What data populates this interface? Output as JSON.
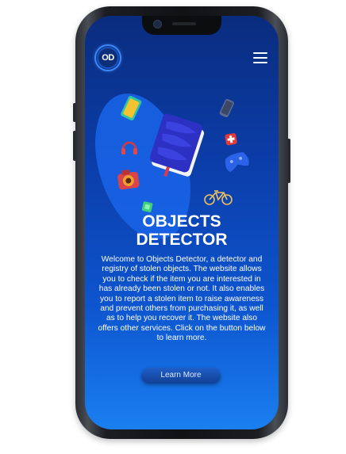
{
  "header": {
    "logo_text": "OD",
    "menu_icon": "hamburger-menu-icon"
  },
  "hero": {
    "title_line1": "OBJECTS",
    "title_line2": "DETECTOR",
    "description": "Welcome to Objects Detector, a detector and registry of stolen objects. The website allows you to check if the item you are interested in has already been stolen or not. It also enables you to report a stolen item to raise awareness and prevent others from purchasing it, as well as to help you recover it. The website also offers other services. Click on the button below to learn more.",
    "cta_label": "Learn More"
  },
  "icons": [
    "book-icon",
    "tablet-icon",
    "phone-icon",
    "first-aid-icon",
    "game-controller-icon",
    "headphones-icon",
    "camera-icon",
    "bicycle-icon",
    "green-item-icon"
  ],
  "colors": {
    "screen_top": "#0a2c7e",
    "screen_bottom": "#1a7ff0",
    "accent": "#3b88ff",
    "text": "#ffffff"
  }
}
